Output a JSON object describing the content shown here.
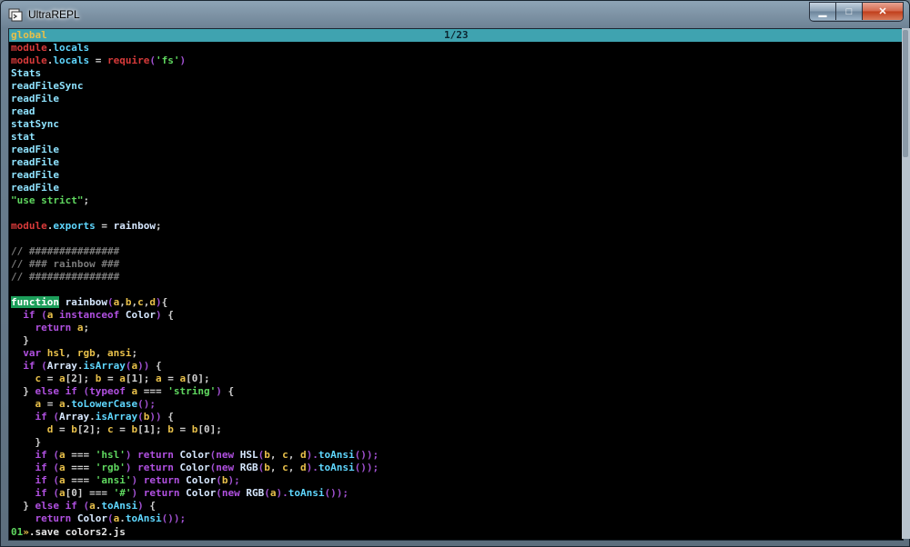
{
  "window": {
    "title": "UltraREPL"
  },
  "controls": {
    "minimize": "▁",
    "maximize": "□",
    "close": "✕"
  },
  "status": {
    "scope": "global",
    "page": "1/23"
  },
  "colors": {
    "status_bg": "#3fa3b0",
    "highlight_bg": "#1c9e5a"
  },
  "code_lines": [
    [
      {
        "t": "module",
        "c": "#d73a3a"
      },
      {
        "t": ".",
        "c": "#cfcfcf"
      },
      {
        "t": "locals",
        "c": "#5fd7ff"
      }
    ],
    [
      {
        "t": "module",
        "c": "#d73a3a"
      },
      {
        "t": ".",
        "c": "#cfcfcf"
      },
      {
        "t": "locals",
        "c": "#5fd7ff"
      },
      {
        "t": " = ",
        "c": "#cfcfcf"
      },
      {
        "t": "require",
        "c": "#d73a3a"
      },
      {
        "t": "(",
        "c": "#a050d0"
      },
      {
        "t": "'fs'",
        "c": "#5fd75f"
      },
      {
        "t": ")",
        "c": "#a050d0"
      }
    ],
    [
      {
        "t": "Stats",
        "c": "#8fe3ff"
      }
    ],
    [
      {
        "t": "readFileSync",
        "c": "#8fe3ff"
      }
    ],
    [
      {
        "t": "readFile",
        "c": "#8fe3ff"
      }
    ],
    [
      {
        "t": "read",
        "c": "#8fe3ff"
      }
    ],
    [
      {
        "t": "statSync",
        "c": "#8fe3ff"
      }
    ],
    [
      {
        "t": "stat",
        "c": "#8fe3ff"
      }
    ],
    [
      {
        "t": "readFile",
        "c": "#8fe3ff"
      }
    ],
    [
      {
        "t": "readFile",
        "c": "#8fe3ff"
      }
    ],
    [
      {
        "t": "readFile",
        "c": "#8fe3ff"
      }
    ],
    [
      {
        "t": "readFile",
        "c": "#8fe3ff"
      }
    ],
    [
      {
        "t": "\"use strict\"",
        "c": "#5fd75f"
      },
      {
        "t": ";",
        "c": "#cfcfcf"
      }
    ],
    [],
    [
      {
        "t": "module",
        "c": "#d73a3a"
      },
      {
        "t": ".",
        "c": "#cfcfcf"
      },
      {
        "t": "exports",
        "c": "#5fd7ff"
      },
      {
        "t": " = ",
        "c": "#cfcfcf"
      },
      {
        "t": "rainbow",
        "c": "#d7e8ff"
      },
      {
        "t": ";",
        "c": "#cfcfcf"
      }
    ],
    [],
    [
      {
        "t": "// ###############",
        "c": "#7a7a7a"
      }
    ],
    [
      {
        "t": "// ### rainbow ###",
        "c": "#7a7a7a"
      }
    ],
    [
      {
        "t": "// ###############",
        "c": "#7a7a7a"
      }
    ],
    [],
    [
      {
        "t": "function",
        "c": "#ffffff",
        "bg": "#1c9e5a"
      },
      {
        "t": " rainbow",
        "c": "#d7e8ff"
      },
      {
        "t": "(",
        "c": "#a050d0"
      },
      {
        "t": "a",
        "c": "#e8c04a"
      },
      {
        "t": ",",
        "c": "#cfcfcf"
      },
      {
        "t": "b",
        "c": "#e8c04a"
      },
      {
        "t": ",",
        "c": "#cfcfcf"
      },
      {
        "t": "c",
        "c": "#e8c04a"
      },
      {
        "t": ",",
        "c": "#cfcfcf"
      },
      {
        "t": "d",
        "c": "#e8c04a"
      },
      {
        "t": ")",
        "c": "#a050d0"
      },
      {
        "t": "{",
        "c": "#cfcfcf"
      }
    ],
    [
      {
        "t": "  if ",
        "c": "#b050e0"
      },
      {
        "t": "(",
        "c": "#a050d0"
      },
      {
        "t": "a ",
        "c": "#e8c04a"
      },
      {
        "t": "instanceof ",
        "c": "#b050e0"
      },
      {
        "t": "Color",
        "c": "#d7e8ff"
      },
      {
        "t": ") ",
        "c": "#a050d0"
      },
      {
        "t": "{",
        "c": "#cfcfcf"
      }
    ],
    [
      {
        "t": "    return ",
        "c": "#b050e0"
      },
      {
        "t": "a",
        "c": "#e8c04a"
      },
      {
        "t": ";",
        "c": "#cfcfcf"
      }
    ],
    [
      {
        "t": "  }",
        "c": "#cfcfcf"
      }
    ],
    [
      {
        "t": "  var ",
        "c": "#b050e0"
      },
      {
        "t": "hsl",
        "c": "#e8c04a"
      },
      {
        "t": ", ",
        "c": "#cfcfcf"
      },
      {
        "t": "rgb",
        "c": "#e8c04a"
      },
      {
        "t": ", ",
        "c": "#cfcfcf"
      },
      {
        "t": "ansi",
        "c": "#e8c04a"
      },
      {
        "t": ";",
        "c": "#cfcfcf"
      }
    ],
    [
      {
        "t": "  if ",
        "c": "#b050e0"
      },
      {
        "t": "(",
        "c": "#a050d0"
      },
      {
        "t": "Array",
        "c": "#d7e8ff"
      },
      {
        "t": ".",
        "c": "#cfcfcf"
      },
      {
        "t": "isArray",
        "c": "#5fd7ff"
      },
      {
        "t": "(",
        "c": "#a050d0"
      },
      {
        "t": "a",
        "c": "#e8c04a"
      },
      {
        "t": ")) ",
        "c": "#a050d0"
      },
      {
        "t": "{",
        "c": "#cfcfcf"
      }
    ],
    [
      {
        "t": "    c",
        "c": "#e8c04a"
      },
      {
        "t": " = ",
        "c": "#cfcfcf"
      },
      {
        "t": "a",
        "c": "#e8c04a"
      },
      {
        "t": "[2]; ",
        "c": "#cfcfcf"
      },
      {
        "t": "b",
        "c": "#e8c04a"
      },
      {
        "t": " = ",
        "c": "#cfcfcf"
      },
      {
        "t": "a",
        "c": "#e8c04a"
      },
      {
        "t": "[1]; ",
        "c": "#cfcfcf"
      },
      {
        "t": "a",
        "c": "#e8c04a"
      },
      {
        "t": " = ",
        "c": "#cfcfcf"
      },
      {
        "t": "a",
        "c": "#e8c04a"
      },
      {
        "t": "[0];",
        "c": "#cfcfcf"
      }
    ],
    [
      {
        "t": "  } ",
        "c": "#cfcfcf"
      },
      {
        "t": "else if ",
        "c": "#b050e0"
      },
      {
        "t": "(",
        "c": "#a050d0"
      },
      {
        "t": "typeof ",
        "c": "#b050e0"
      },
      {
        "t": "a",
        "c": "#e8c04a"
      },
      {
        "t": " === ",
        "c": "#cfcfcf"
      },
      {
        "t": "'string'",
        "c": "#5fd75f"
      },
      {
        "t": ") ",
        "c": "#a050d0"
      },
      {
        "t": "{",
        "c": "#cfcfcf"
      }
    ],
    [
      {
        "t": "    a",
        "c": "#e8c04a"
      },
      {
        "t": " = ",
        "c": "#cfcfcf"
      },
      {
        "t": "a",
        "c": "#e8c04a"
      },
      {
        "t": ".",
        "c": "#cfcfcf"
      },
      {
        "t": "toLowerCase",
        "c": "#5fd7ff"
      },
      {
        "t": "();",
        "c": "#a050d0"
      }
    ],
    [
      {
        "t": "    if ",
        "c": "#b050e0"
      },
      {
        "t": "(",
        "c": "#a050d0"
      },
      {
        "t": "Array",
        "c": "#d7e8ff"
      },
      {
        "t": ".",
        "c": "#cfcfcf"
      },
      {
        "t": "isArray",
        "c": "#5fd7ff"
      },
      {
        "t": "(",
        "c": "#a050d0"
      },
      {
        "t": "b",
        "c": "#e8c04a"
      },
      {
        "t": ")) ",
        "c": "#a050d0"
      },
      {
        "t": "{",
        "c": "#cfcfcf"
      }
    ],
    [
      {
        "t": "      d",
        "c": "#e8c04a"
      },
      {
        "t": " = ",
        "c": "#cfcfcf"
      },
      {
        "t": "b",
        "c": "#e8c04a"
      },
      {
        "t": "[2]; ",
        "c": "#cfcfcf"
      },
      {
        "t": "c",
        "c": "#e8c04a"
      },
      {
        "t": " = ",
        "c": "#cfcfcf"
      },
      {
        "t": "b",
        "c": "#e8c04a"
      },
      {
        "t": "[1]; ",
        "c": "#cfcfcf"
      },
      {
        "t": "b",
        "c": "#e8c04a"
      },
      {
        "t": " = ",
        "c": "#cfcfcf"
      },
      {
        "t": "b",
        "c": "#e8c04a"
      },
      {
        "t": "[0];",
        "c": "#cfcfcf"
      }
    ],
    [
      {
        "t": "    }",
        "c": "#cfcfcf"
      }
    ],
    [
      {
        "t": "    if ",
        "c": "#b050e0"
      },
      {
        "t": "(",
        "c": "#a050d0"
      },
      {
        "t": "a",
        "c": "#e8c04a"
      },
      {
        "t": " === ",
        "c": "#cfcfcf"
      },
      {
        "t": "'hsl'",
        "c": "#5fd75f"
      },
      {
        "t": ") ",
        "c": "#a050d0"
      },
      {
        "t": "return ",
        "c": "#b050e0"
      },
      {
        "t": "Color",
        "c": "#d7e8ff"
      },
      {
        "t": "(",
        "c": "#a050d0"
      },
      {
        "t": "new ",
        "c": "#b050e0"
      },
      {
        "t": "HSL",
        "c": "#d7e8ff"
      },
      {
        "t": "(",
        "c": "#a050d0"
      },
      {
        "t": "b",
        "c": "#e8c04a"
      },
      {
        "t": ", ",
        "c": "#cfcfcf"
      },
      {
        "t": "c",
        "c": "#e8c04a"
      },
      {
        "t": ", ",
        "c": "#cfcfcf"
      },
      {
        "t": "d",
        "c": "#e8c04a"
      },
      {
        "t": ").",
        "c": "#a050d0"
      },
      {
        "t": "toAnsi",
        "c": "#5fd7ff"
      },
      {
        "t": "());",
        "c": "#a050d0"
      }
    ],
    [
      {
        "t": "    if ",
        "c": "#b050e0"
      },
      {
        "t": "(",
        "c": "#a050d0"
      },
      {
        "t": "a",
        "c": "#e8c04a"
      },
      {
        "t": " === ",
        "c": "#cfcfcf"
      },
      {
        "t": "'rgb'",
        "c": "#5fd75f"
      },
      {
        "t": ") ",
        "c": "#a050d0"
      },
      {
        "t": "return ",
        "c": "#b050e0"
      },
      {
        "t": "Color",
        "c": "#d7e8ff"
      },
      {
        "t": "(",
        "c": "#a050d0"
      },
      {
        "t": "new ",
        "c": "#b050e0"
      },
      {
        "t": "RGB",
        "c": "#d7e8ff"
      },
      {
        "t": "(",
        "c": "#a050d0"
      },
      {
        "t": "b",
        "c": "#e8c04a"
      },
      {
        "t": ", ",
        "c": "#cfcfcf"
      },
      {
        "t": "c",
        "c": "#e8c04a"
      },
      {
        "t": ", ",
        "c": "#cfcfcf"
      },
      {
        "t": "d",
        "c": "#e8c04a"
      },
      {
        "t": ").",
        "c": "#a050d0"
      },
      {
        "t": "toAnsi",
        "c": "#5fd7ff"
      },
      {
        "t": "());",
        "c": "#a050d0"
      }
    ],
    [
      {
        "t": "    if ",
        "c": "#b050e0"
      },
      {
        "t": "(",
        "c": "#a050d0"
      },
      {
        "t": "a",
        "c": "#e8c04a"
      },
      {
        "t": " === ",
        "c": "#cfcfcf"
      },
      {
        "t": "'ansi'",
        "c": "#5fd75f"
      },
      {
        "t": ") ",
        "c": "#a050d0"
      },
      {
        "t": "return ",
        "c": "#b050e0"
      },
      {
        "t": "Color",
        "c": "#d7e8ff"
      },
      {
        "t": "(",
        "c": "#a050d0"
      },
      {
        "t": "b",
        "c": "#e8c04a"
      },
      {
        "t": ");",
        "c": "#a050d0"
      }
    ],
    [
      {
        "t": "    if ",
        "c": "#b050e0"
      },
      {
        "t": "(",
        "c": "#a050d0"
      },
      {
        "t": "a",
        "c": "#e8c04a"
      },
      {
        "t": "[0] === ",
        "c": "#cfcfcf"
      },
      {
        "t": "'#'",
        "c": "#5fd75f"
      },
      {
        "t": ") ",
        "c": "#a050d0"
      },
      {
        "t": "return ",
        "c": "#b050e0"
      },
      {
        "t": "Color",
        "c": "#d7e8ff"
      },
      {
        "t": "(",
        "c": "#a050d0"
      },
      {
        "t": "new ",
        "c": "#b050e0"
      },
      {
        "t": "RGB",
        "c": "#d7e8ff"
      },
      {
        "t": "(",
        "c": "#a050d0"
      },
      {
        "t": "a",
        "c": "#e8c04a"
      },
      {
        "t": ").",
        "c": "#a050d0"
      },
      {
        "t": "toAnsi",
        "c": "#5fd7ff"
      },
      {
        "t": "());",
        "c": "#a050d0"
      }
    ],
    [
      {
        "t": "  } ",
        "c": "#cfcfcf"
      },
      {
        "t": "else if ",
        "c": "#b050e0"
      },
      {
        "t": "(",
        "c": "#a050d0"
      },
      {
        "t": "a",
        "c": "#e8c04a"
      },
      {
        "t": ".",
        "c": "#cfcfcf"
      },
      {
        "t": "toAnsi",
        "c": "#5fd7ff"
      },
      {
        "t": ") ",
        "c": "#a050d0"
      },
      {
        "t": "{",
        "c": "#cfcfcf"
      }
    ],
    [
      {
        "t": "    return ",
        "c": "#b050e0"
      },
      {
        "t": "Color",
        "c": "#d7e8ff"
      },
      {
        "t": "(",
        "c": "#a050d0"
      },
      {
        "t": "a",
        "c": "#e8c04a"
      },
      {
        "t": ".",
        "c": "#cfcfcf"
      },
      {
        "t": "toAnsi",
        "c": "#5fd7ff"
      },
      {
        "t": "());",
        "c": "#a050d0"
      }
    ]
  ],
  "prompt": {
    "number": "01",
    "arrow": "»",
    "input": ".save colors2.js"
  }
}
